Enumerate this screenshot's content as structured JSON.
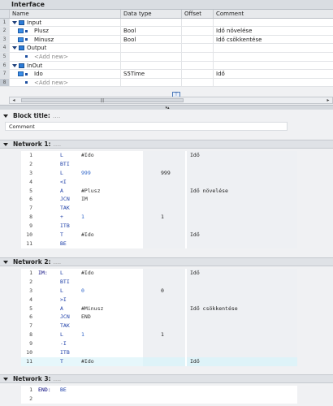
{
  "interface": {
    "title": "Interface",
    "columns": {
      "name": "Name",
      "type": "Data type",
      "offset": "Offset",
      "comment": "Comment"
    },
    "rows": [
      {
        "num": "1",
        "name": "Input",
        "type": "",
        "offset": "",
        "comment": ""
      },
      {
        "num": "2",
        "name": "Plusz",
        "type": "Bool",
        "offset": "",
        "comment": "Idő növelése"
      },
      {
        "num": "3",
        "name": "Minusz",
        "type": "Bool",
        "offset": "",
        "comment": "Idő csökkentése"
      },
      {
        "num": "4",
        "name": "Output",
        "type": "",
        "offset": "",
        "comment": ""
      },
      {
        "num": "5",
        "name": "<Add new>",
        "type": "",
        "offset": "",
        "comment": ""
      },
      {
        "num": "6",
        "name": "InOut",
        "type": "",
        "offset": "",
        "comment": ""
      },
      {
        "num": "7",
        "name": "Ido",
        "type": "S5Time",
        "offset": "",
        "comment": "Idő"
      },
      {
        "num": "8",
        "name": "<Add new>",
        "type": "",
        "offset": "",
        "comment": ""
      }
    ],
    "scroll_grip": "|||"
  },
  "block_title": {
    "label": "Block title:",
    "dots": "....",
    "comment": "Comment"
  },
  "networks": [
    {
      "label": "Network 1:",
      "dots": "....",
      "lines": [
        {
          "n": "1",
          "lbl": "",
          "op": "L",
          "arg": "#Ido",
          "val": "",
          "com": "Idő"
        },
        {
          "n": "2",
          "lbl": "",
          "op": "BTI",
          "arg": "",
          "val": "",
          "com": ""
        },
        {
          "n": "3",
          "lbl": "",
          "op": "L",
          "arg": "999",
          "val": "999",
          "com": ""
        },
        {
          "n": "4",
          "lbl": "",
          "op": "<I",
          "arg": "",
          "val": "",
          "com": ""
        },
        {
          "n": "5",
          "lbl": "",
          "op": "A",
          "arg": "#Plusz",
          "val": "",
          "com": "Idő növelése"
        },
        {
          "n": "6",
          "lbl": "",
          "op": "JCN",
          "arg": "IM",
          "val": "",
          "com": ""
        },
        {
          "n": "7",
          "lbl": "",
          "op": "TAK",
          "arg": "",
          "val": "",
          "com": ""
        },
        {
          "n": "8",
          "lbl": "",
          "op": "+",
          "arg": "1",
          "val": "1",
          "com": ""
        },
        {
          "n": "9",
          "lbl": "",
          "op": "ITB",
          "arg": "",
          "val": "",
          "com": ""
        },
        {
          "n": "10",
          "lbl": "",
          "op": "T",
          "arg": "#Ido",
          "val": "",
          "com": "Idő"
        },
        {
          "n": "11",
          "lbl": "",
          "op": "BE",
          "arg": "",
          "val": "",
          "com": ""
        }
      ]
    },
    {
      "label": "Network 2:",
      "dots": "....",
      "lines": [
        {
          "n": "1",
          "lbl": "IM:",
          "op": "L",
          "arg": "#Ido",
          "val": "",
          "com": "Idő"
        },
        {
          "n": "2",
          "lbl": "",
          "op": "BTI",
          "arg": "",
          "val": "",
          "com": ""
        },
        {
          "n": "3",
          "lbl": "",
          "op": "L",
          "arg": "0",
          "val": "0",
          "com": ""
        },
        {
          "n": "4",
          "lbl": "",
          "op": ">I",
          "arg": "",
          "val": "",
          "com": ""
        },
        {
          "n": "5",
          "lbl": "",
          "op": "A",
          "arg": "#Minusz",
          "val": "",
          "com": "Idő csökkentése"
        },
        {
          "n": "6",
          "lbl": "",
          "op": "JCN",
          "arg": "END",
          "val": "",
          "com": ""
        },
        {
          "n": "7",
          "lbl": "",
          "op": "TAK",
          "arg": "",
          "val": "",
          "com": ""
        },
        {
          "n": "8",
          "lbl": "",
          "op": "L",
          "arg": "1",
          "val": "1",
          "com": ""
        },
        {
          "n": "9",
          "lbl": "",
          "op": "-I",
          "arg": "",
          "val": "",
          "com": ""
        },
        {
          "n": "10",
          "lbl": "",
          "op": "ITB",
          "arg": "",
          "val": "",
          "com": ""
        },
        {
          "n": "11",
          "lbl": "",
          "op": "T",
          "arg": "#Ido",
          "val": "",
          "com": "Idő"
        }
      ]
    },
    {
      "label": "Network 3:",
      "dots": "....",
      "lines": [
        {
          "n": "1",
          "lbl": "END:",
          "op": "BE",
          "arg": "",
          "val": "",
          "com": ""
        },
        {
          "n": "2",
          "lbl": "",
          "op": "",
          "arg": "",
          "val": "",
          "com": ""
        }
      ]
    }
  ]
}
